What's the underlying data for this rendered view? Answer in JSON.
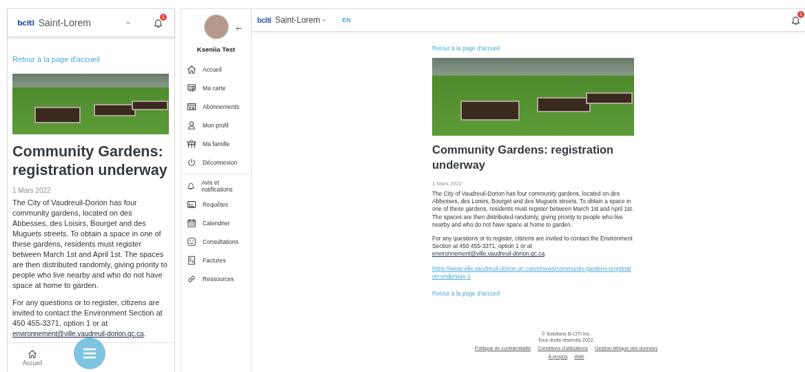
{
  "mobile": {
    "header": {
      "logo": "bciti",
      "city": "Saint-Lorem",
      "notification_count": "1"
    },
    "back_link": "Retour à la page d'accueil",
    "article": {
      "title": "Community Gardens: registration underway",
      "date": "1 Mars 2022",
      "paragraph": "The City of Vaudreuil-Dorion has four community gardens, located on des Abbesses, des Loisirs, Bourget and des Muguets streets. To obtain a space in one of these gardens, residents must register between March 1st and April 1st. The spaces are then distributed randomly, giving priority to people who live nearby and who do not have space at home to garden.",
      "contact_text": "For any questions or to register, citizens are invited to contact the Environment Section at 450 455-3371, option 1 or at",
      "email": "environnement@ville.vaudreuil-dorion.qc.ca",
      "contact_end": "."
    },
    "bottom_nav": [
      {
        "label": "Accueil"
      }
    ]
  },
  "sidebar": {
    "user_name": "Kseniia Test",
    "groups": [
      [
        {
          "label": "Accueil"
        },
        {
          "label": "Ma carte"
        },
        {
          "label": "Abonnements"
        },
        {
          "label": "Mon profil"
        },
        {
          "label": "Ma famille"
        },
        {
          "label": "Déconnexion"
        }
      ],
      [
        {
          "label": "Avis et notifications"
        },
        {
          "label": "Requêtes"
        },
        {
          "label": "Calendrier"
        },
        {
          "label": "Consultations"
        },
        {
          "label": "Factures"
        },
        {
          "label": "Ressources"
        }
      ]
    ]
  },
  "desktop": {
    "header": {
      "logo": "bciti",
      "city": "Saint-Lorem",
      "language": {
        "label": "EN",
        "selected": true
      },
      "notification_count": "1"
    },
    "back_link_top": "Retour à la page d'accueil",
    "article": {
      "title": "Community Gardens: registration underway",
      "date": "1 Mars 2022",
      "paragraph": "The City of Vaudreuil-Dorion has four community gardens, located on des Abbesses, des Loisirs, Bourget and des Muguets streets. To obtain a space in one of these gardens, residents must register between March 1st and April 1st. The spaces are then distributed randomly, giving priority to people who live nearby and who do not have space at home to garden.",
      "contact_text": "For any questions or to register, citizens are invited to contact the Environment Section at 450 455-3371, option 1 or at",
      "email": "environnement@ville.vaudreuil-dorion.qc.ca",
      "contact_end": ".",
      "source_link": "https://www.ville.vaudreuil-dorion.qc.ca/en/news/community-gardens-registration-underway-1"
    },
    "back_link_bottom": "Retour à la page d'accueil",
    "footer": {
      "copyright": "© Solutions B-CITI Inc.",
      "rights": "Tous droits réservés 2022.",
      "links": [
        [
          "Politique de confidentialité",
          "Conditions d'utilisations",
          "Gestion éthique des données"
        ],
        [
          "À propos",
          "Aide"
        ]
      ]
    }
  }
}
